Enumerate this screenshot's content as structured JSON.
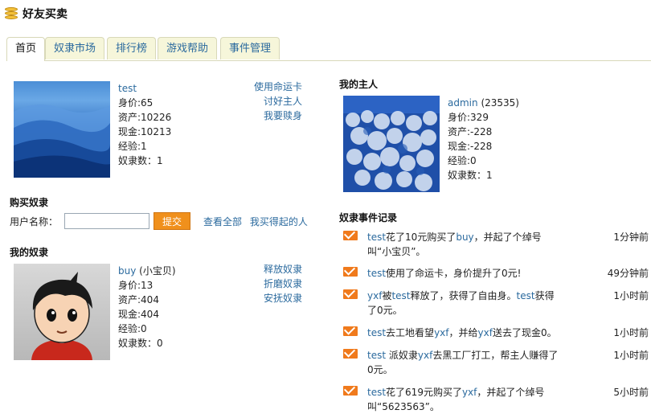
{
  "header": {
    "title": "好友买卖"
  },
  "tabs": [
    "首页",
    "奴隶市场",
    "排行榜",
    "游戏帮助",
    "事件管理"
  ],
  "me": {
    "name": "test",
    "stats": [
      "身价:65",
      "资产:10226",
      "现金:10213",
      "经验:1",
      "奴隶数：1"
    ],
    "actions": [
      "使用命运卡",
      "讨好主人",
      "我要赎身"
    ]
  },
  "buy": {
    "title": "购买奴隶",
    "label": "用户名称：",
    "button": "提交",
    "links": [
      "查看全部",
      "我买得起的人"
    ]
  },
  "slaves": {
    "title": "我的奴隶",
    "name": "buy",
    "nickname": "(小宝贝)",
    "stats": [
      "身价:13",
      "资产:404",
      "现金:404",
      "经验:0",
      "奴隶数：0"
    ],
    "actions": [
      "释放奴隶",
      "折磨奴隶",
      "安抚奴隶"
    ]
  },
  "master": {
    "title": "我的主人",
    "name": "admin",
    "score": "(23535)",
    "stats": [
      "身价:329",
      "资产:-228",
      "现金:-228",
      "经验:0",
      "奴隶数：1"
    ]
  },
  "events": {
    "title": "奴隶事件记录",
    "items": [
      {
        "parts": [
          [
            "test",
            true
          ],
          [
            "花了10元购买了",
            false
          ],
          [
            "buy",
            true
          ],
          [
            "，并起了个绰号叫“小宝贝”。",
            false
          ]
        ],
        "time": "1分钟前"
      },
      {
        "parts": [
          [
            "test",
            true
          ],
          [
            "使用了命运卡，身价提升了0元!",
            false
          ]
        ],
        "time": "49分钟前"
      },
      {
        "parts": [
          [
            "yxf",
            true
          ],
          [
            "被",
            false
          ],
          [
            "test",
            true
          ],
          [
            "释放了，获得了自由身。",
            false
          ],
          [
            "test",
            true
          ],
          [
            "获得了0元。",
            false
          ]
        ],
        "time": "1小时前"
      },
      {
        "parts": [
          [
            "test",
            true
          ],
          [
            "去工地看望",
            false
          ],
          [
            "yxf",
            true
          ],
          [
            "，并给",
            false
          ],
          [
            "yxf",
            true
          ],
          [
            "送去了现金0。",
            false
          ]
        ],
        "time": "1小时前"
      },
      {
        "parts": [
          [
            "test",
            true
          ],
          [
            " 派奴隶",
            false
          ],
          [
            "yxf",
            true
          ],
          [
            "去黑工厂打工，帮主人赚得了0元。",
            false
          ]
        ],
        "time": "1小时前"
      },
      {
        "parts": [
          [
            "test",
            true
          ],
          [
            "花了619元购买了",
            false
          ],
          [
            "yxf",
            true
          ],
          [
            "，并起了个绰号叫“5623563”。",
            false
          ]
        ],
        "time": "5小时前"
      }
    ]
  }
}
